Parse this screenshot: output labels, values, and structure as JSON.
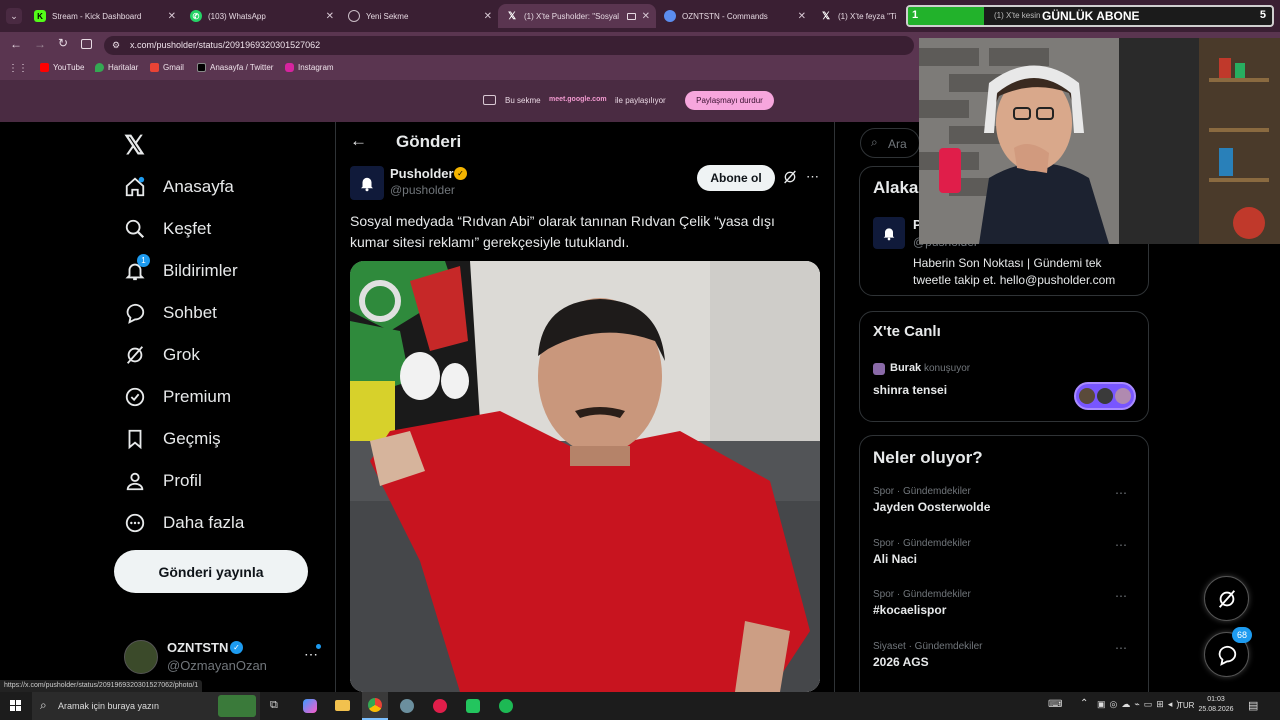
{
  "tabs": [
    {
      "label": "Stream - Kick Dashboard",
      "favicon": "K",
      "color": "#53fc18"
    },
    {
      "label": "(103) WhatsApp",
      "favicon": "W",
      "color": "#25d366"
    },
    {
      "label": "Yeni Sekme",
      "favicon": "○",
      "color": "#9aa0a6"
    },
    {
      "label": "(1) X'te Pusholder: \"Sosyal",
      "favicon": "X",
      "color": "#ffffff"
    },
    {
      "label": "OZNTSTN - Commands",
      "favicon": "●",
      "color": "#5b8def"
    },
    {
      "label": "(1) X'te feyza \"Ti",
      "favicon": "X",
      "color": "#ffffff"
    },
    {
      "label": "(1) X'te kesin",
      "favicon": "X",
      "color": "#ffffff"
    }
  ],
  "url": "x.com/pusholder/status/2091969320301527062",
  "bookmarks": [
    "YouTube",
    "Haritalar",
    "Gmail",
    "Anasayfa / Twitter",
    "Instagram"
  ],
  "share": {
    "prefix": "Bu sekme",
    "domain": "meet.google.com",
    "suffix": "ile paylaşılıyor",
    "button": "Paylaşmayı durdur"
  },
  "overlay": {
    "count": "1",
    "label": "GÜNLÜK ABONE",
    "goal": "5"
  },
  "nav": {
    "items": [
      "Anasayfa",
      "Keşfet",
      "Bildirimler",
      "Sohbet",
      "Grok",
      "Premium",
      "Geçmiş",
      "Profil",
      "Daha fazla"
    ],
    "notif_badge": "1",
    "post_button": "Gönderi yayınla"
  },
  "account": {
    "name": "OZNTSTN",
    "handle": "@OzmayanOzan"
  },
  "post": {
    "header": "Gönderi",
    "author": "Pusholder",
    "handle": "@pusholder",
    "follow": "Abone ol",
    "text_line1": "Sosyal medyada “Rıdvan Abi” olarak tanınan Rıdvan Çelik “yasa dışı",
    "text_line2": "kumar sitesi reklamı” gerekçesiyle tutuklandı."
  },
  "right": {
    "search_placeholder": "Ara",
    "relevant_title": "Alaka",
    "relevant_name": "P",
    "relevant_handle": "@pusholder",
    "bio_line1": "Haberin Son Noktası | Gündemi tek",
    "bio_line2": "tweetle takip et. hello@pusholder.com",
    "live_title": "X'te Canlı",
    "live_user": "Burak",
    "live_status": "konuşuyor",
    "live_topic": "shinra tensei",
    "trends_title": "Neler oluyor?",
    "trends": [
      {
        "cat": "Spor · Gündemdekiler",
        "name": "Jayden Oosterwolde"
      },
      {
        "cat": "Spor · Gündemdekiler",
        "name": "Ali Naci"
      },
      {
        "cat": "Spor · Gündemdekiler",
        "name": "#kocaelispor"
      },
      {
        "cat": "Siyaset · Gündemdekiler",
        "name": "2026 AGS"
      }
    ],
    "messages_badge": "68"
  },
  "status_url": "https://x.com/pusholder/status/2091969320301527062/photo/1",
  "taskbar": {
    "search": "Aramak için buraya yazın",
    "lang": "TUR",
    "time": "01:03",
    "date": "25.08.2026"
  }
}
